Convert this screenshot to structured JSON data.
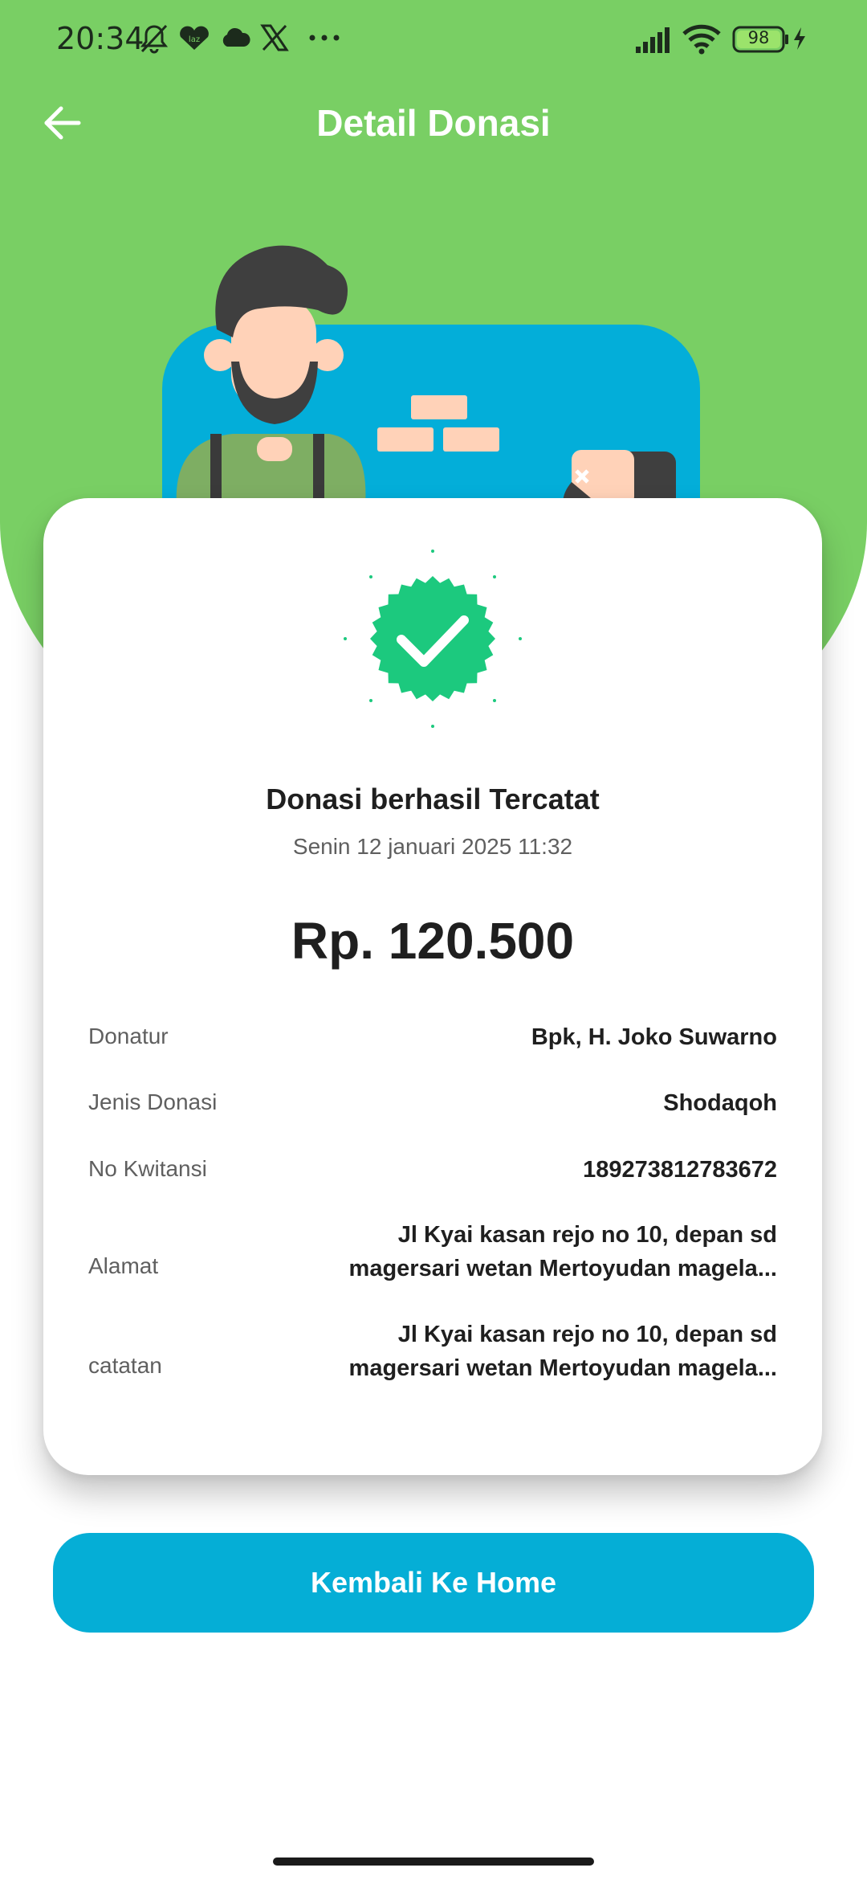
{
  "status_bar": {
    "time": "20:34",
    "battery": "98",
    "icons": [
      "bell-off-icon",
      "lazada-icon",
      "cloud-icon",
      "x-icon",
      "more-dots-icon",
      "signal-icon",
      "wifi-icon",
      "battery-icon",
      "charging-icon"
    ]
  },
  "header": {
    "title": "Detail Donasi",
    "back_icon": "arrow-left-icon"
  },
  "colors": {
    "header_green": "#79cf64",
    "accent_blue": "#05aed6",
    "success_green": "#1cc97e"
  },
  "receipt": {
    "title": "Donasi berhasil Tercatat",
    "date": "Senin 12 januari 2025 11:32",
    "amount": "Rp. 120.500",
    "rows": [
      {
        "label": "Donatur",
        "value": "Bpk, H. Joko Suwarno"
      },
      {
        "label": "Jenis Donasi",
        "value": "Shodaqoh"
      },
      {
        "label": "No Kwitansi",
        "value": "189273812783672"
      },
      {
        "label": "Alamat",
        "value_line1": "Jl Kyai kasan rejo no 10, depan sd",
        "value_line2": "magersari wetan Mertoyudan magela..."
      },
      {
        "label": "catatan",
        "value_line1": "Jl Kyai kasan rejo no 10, depan sd",
        "value_line2": "magersari wetan Mertoyudan magela..."
      }
    ]
  },
  "actions": {
    "home_button": "Kembali Ke Home"
  }
}
